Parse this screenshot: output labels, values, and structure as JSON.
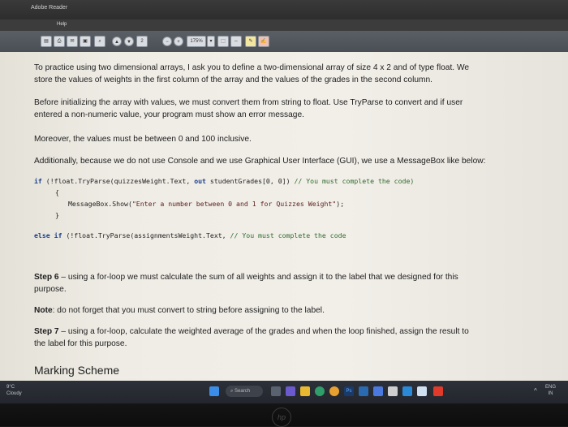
{
  "window": {
    "title": "Adobe Reader",
    "menu_item": "Help"
  },
  "toolbar": {
    "page_number": "2",
    "zoom": "175%"
  },
  "document": {
    "paragraph1_line1": "To practice using two dimensional arrays, I ask you to define a two-dimensional array of size 4 x 2 and of type float. We",
    "paragraph1_line2": "store the values of weights in the first column of the array and the values of the grades in the second column.",
    "paragraph2_line1": "Before initializing the array with values, we must convert them from string to float. Use TryParse to convert and if user",
    "paragraph2_line2": "entered a non-numeric value, your program must show an error message.",
    "paragraph3": "Moreover, the values must be between 0 and 100 inclusive.",
    "paragraph4": "Additionally, because we do not use Console and we use Graphical User Interface (GUI), we use a MessageBox like below:",
    "code": {
      "line1_kw": "if",
      "line1_rest": " (!float.TryParse(quizzesWeight.Text, ",
      "line1_out": "out",
      "line1_tail": " studentGrades[0, 0]) ",
      "line1_comment": "// You must complete the code)",
      "line2": "{",
      "line3_pre": "MessageBox.Show(",
      "line3_str": "\"Enter a number between 0 and 1 for Quizzes Weight\"",
      "line3_post": ");",
      "line4": "}",
      "line5_kw": "else if",
      "line5_rest": " (!float.TryParse(assignmentsWeight.Text, ",
      "line5_comment": "// You must complete the code"
    },
    "step6_label": "Step 6",
    "step6_line1": " – using a for-loop we must calculate the sum of all weights and assign it to the label that we designed for this",
    "step6_line2": "purpose.",
    "note_label": "Note",
    "note_text": ": do not forget that you must convert to string before assigning to the label.",
    "step7_label": "Step 7",
    "step7_line1": " – using a for-loop, calculate the weighted average of the grades and when the loop finished, assign the result to",
    "step7_line2": "the label for this purpose.",
    "marking_heading": "Marking Scheme"
  },
  "taskbar": {
    "weather_temp": "9°C",
    "weather_desc": "Cloudy",
    "search_label": "Search",
    "lang_top": "ENG",
    "lang_bottom": "IN"
  },
  "bezel": {
    "logo": "hp"
  },
  "colors": {
    "keyword": "#1b3f8a",
    "comment": "#2e6b2e",
    "taskbar": "#23262d"
  }
}
